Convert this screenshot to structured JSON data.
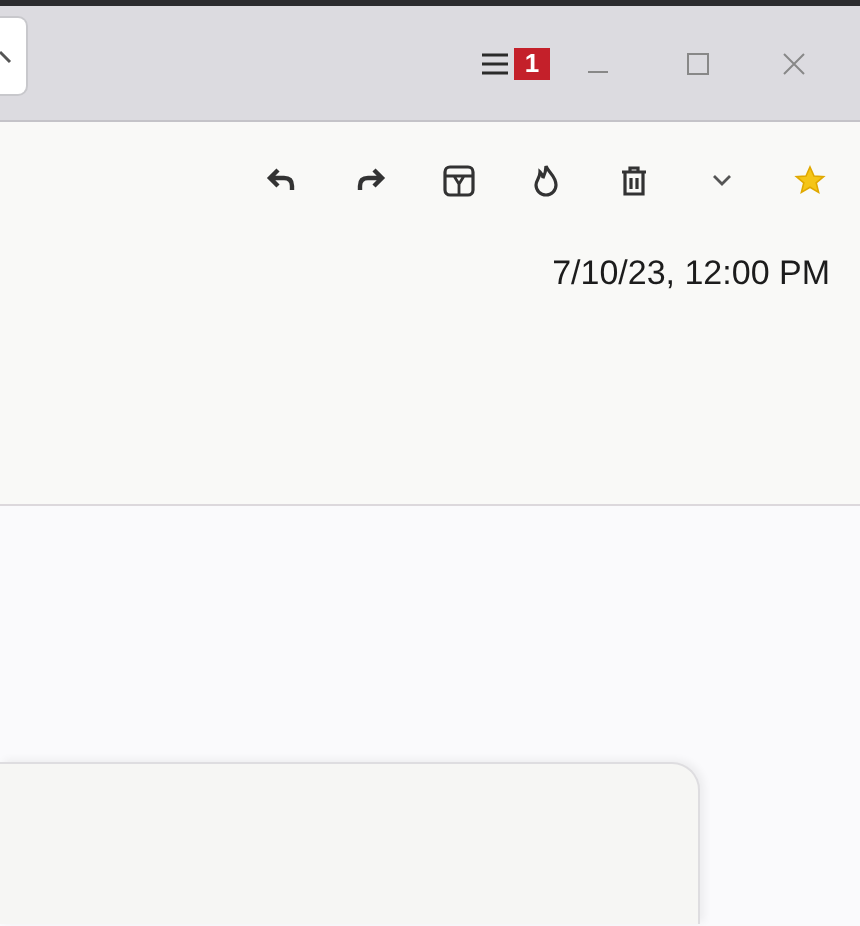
{
  "title_bar": {
    "notification_badge": "1"
  },
  "message_header": {
    "starred": true,
    "date": "7/10/23, 12:00 PM"
  }
}
